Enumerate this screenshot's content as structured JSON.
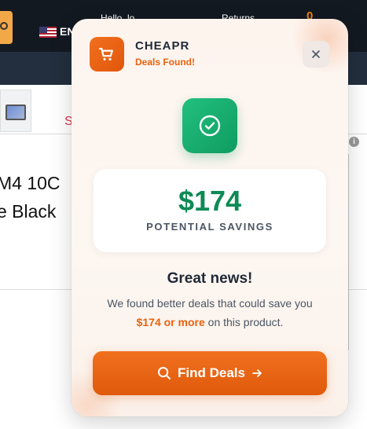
{
  "background_page": {
    "language": "EN",
    "hello_text": "Hello, lo",
    "returns_text": "Returns",
    "cart_count": "0",
    "red_fragment": "S",
    "info_glyph": "i",
    "product_title_line1": "M4 10C",
    "product_title_line2": "e Black"
  },
  "popup": {
    "brand": "CHEAPR",
    "subtitle": "Deals Found!",
    "logo_icon": "shopping-cart-icon",
    "close_icon": "close-icon",
    "status_icon": "check-circle-icon",
    "savings_amount": "$174",
    "savings_label": "POTENTIAL SAVINGS",
    "headline": "Great news!",
    "description_line1": "We found better deals that could save you",
    "description_highlight": "$174 or more",
    "description_rest": " on this product.",
    "cta_label": "Find Deals",
    "cta_icons": [
      "search-icon",
      "arrow-right-icon"
    ]
  },
  "colors": {
    "brand_orange": "#E8620F",
    "success_green": "#0D8A55",
    "header_dark": "#131921"
  }
}
